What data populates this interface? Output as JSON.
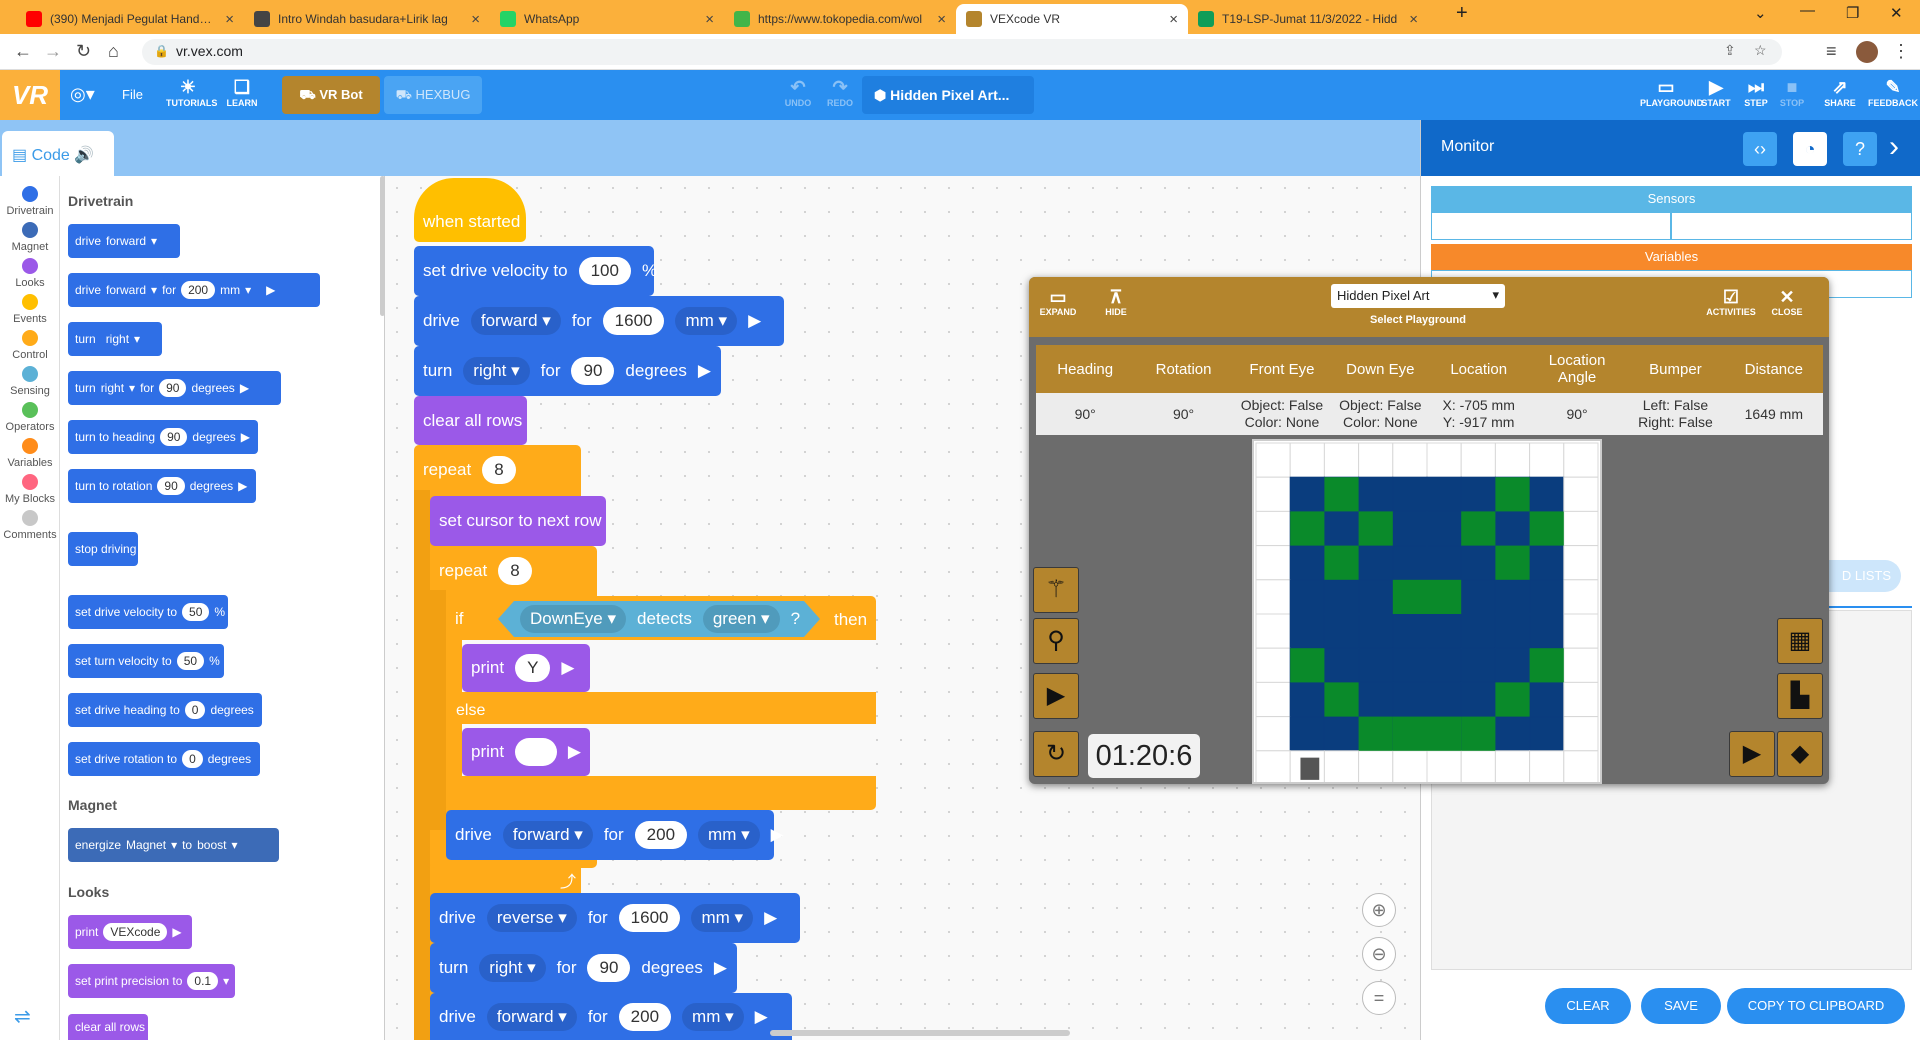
{
  "browser": {
    "tabs": [
      {
        "title": "(390) Menjadi Pegulat Handal - Y",
        "icon": "youtube-icon",
        "color": "#ff0000"
      },
      {
        "title": "Intro Windah basudara+Lirik lag",
        "icon": "music-note-icon",
        "color": "#444444"
      },
      {
        "title": "WhatsApp",
        "icon": "whatsapp-icon",
        "color": "#25d366"
      },
      {
        "title": "https://www.tokopedia.com/wol",
        "icon": "tokopedia-icon",
        "color": "#42b549"
      },
      {
        "title": "VEXcode VR",
        "icon": "vex-icon",
        "color": "#b4852d",
        "active": true
      },
      {
        "title": "T19-LSP-Jumat 11/3/2022 - Hidd",
        "icon": "sheets-icon",
        "color": "#0f9d58"
      }
    ],
    "new_tab": "+",
    "url": "vr.vex.com"
  },
  "header": {
    "logo": "VR",
    "file": "File",
    "tutorials": "TUTORIALS",
    "learn": "LEARN",
    "robots": [
      "VR Bot",
      "HEXBUG"
    ],
    "undo": "UNDO",
    "redo": "REDO",
    "project": "Hidden Pixel Art...",
    "right_buttons": [
      "PLAYGROUND",
      "START",
      "STEP",
      "STOP",
      "SHARE",
      "FEEDBACK"
    ]
  },
  "code_tab": "Code",
  "categories": [
    {
      "label": "Drivetrain",
      "color": "#2f6fe6"
    },
    {
      "label": "Magnet",
      "color": "#3c6bb7"
    },
    {
      "label": "Looks",
      "color": "#9b59e8"
    },
    {
      "label": "Events",
      "color": "#ffbf00"
    },
    {
      "label": "Control",
      "color": "#ffab19"
    },
    {
      "label": "Sensing",
      "color": "#5cb1d6"
    },
    {
      "label": "Operators",
      "color": "#59c059"
    },
    {
      "label": "Variables",
      "color": "#ff8c1a"
    },
    {
      "label": "My Blocks",
      "color": "#ff6680"
    },
    {
      "label": "Comments",
      "color": "#c8c8c8"
    }
  ],
  "palette": {
    "drivetrain_title": "Drivetrain",
    "drive": {
      "label": "drive",
      "dir": "forward"
    },
    "drive_for": {
      "label": "drive",
      "dir": "forward",
      "for": "for",
      "value": "200",
      "unit": "mm"
    },
    "turn": {
      "label": "turn",
      "dir": "right"
    },
    "turn_for": {
      "label": "turn",
      "dir": "right",
      "for": "for",
      "value": "90",
      "unit": "degrees"
    },
    "turn_heading": {
      "label": "turn to heading",
      "value": "90",
      "unit": "degrees"
    },
    "turn_rotation": {
      "label": "turn to rotation",
      "value": "90",
      "unit": "degrees"
    },
    "stop": "stop driving",
    "drive_velocity": {
      "label": "set drive velocity to",
      "value": "50",
      "unit": "%"
    },
    "turn_velocity": {
      "label": "set turn velocity to",
      "value": "50",
      "unit": "%"
    },
    "drive_heading": {
      "label": "set drive heading to",
      "value": "0",
      "unit": "degrees"
    },
    "drive_rotation": {
      "label": "set drive rotation to",
      "value": "0",
      "unit": "degrees"
    },
    "magnet_title": "Magnet",
    "energize": {
      "label": "energize",
      "target": "Magnet",
      "to": "to",
      "mode": "boost"
    },
    "looks_title": "Looks",
    "print": {
      "label": "print",
      "value": "VEXcode"
    },
    "precision": {
      "label": "set print precision to",
      "value": "0.1"
    },
    "clear": "clear all rows"
  },
  "script": {
    "when_started": "when started",
    "velocity": {
      "label": "set drive velocity to",
      "value": "100",
      "unit": "%"
    },
    "drive1": {
      "label": "drive",
      "dir": "forward",
      "for": "for",
      "value": "1600",
      "unit": "mm"
    },
    "turn1": {
      "label": "turn",
      "dir": "right",
      "for": "for",
      "value": "90",
      "unit": "degrees"
    },
    "clear": "clear all rows",
    "repeat1": {
      "label": "repeat",
      "value": "8"
    },
    "next_row": "set cursor to next row",
    "repeat2": {
      "label": "repeat",
      "value": "8"
    },
    "if": {
      "label": "if",
      "sensor": "DownEye",
      "detects": "detects",
      "color": "green",
      "q": "?",
      "then": "then"
    },
    "print_y": {
      "label": "print",
      "value": "Y"
    },
    "else": "else",
    "print_blank": {
      "label": "print",
      "value": ""
    },
    "drive2": {
      "label": "drive",
      "dir": "forward",
      "for": "for",
      "value": "200",
      "unit": "mm"
    },
    "drive3": {
      "label": "drive",
      "dir": "reverse",
      "for": "for",
      "value": "1600",
      "unit": "mm"
    },
    "turn2": {
      "label": "turn",
      "dir": "right",
      "for": "for",
      "value": "90",
      "unit": "degrees"
    },
    "drive4": {
      "label": "drive",
      "dir": "forward",
      "for": "for",
      "value": "200",
      "unit": "mm"
    }
  },
  "monitor": {
    "title": "Monitor",
    "sensors": "Sensors",
    "variables": "Variables",
    "lists_partial": "D LISTS",
    "buttons": [
      "CLEAR",
      "SAVE",
      "COPY TO CLIPBOARD"
    ]
  },
  "playground": {
    "expand": "EXPAND",
    "hide": "HIDE",
    "select_value": "Hidden Pixel Art",
    "select_label": "Select Playground",
    "activities": "ACTIVITIES",
    "close": "CLOSE",
    "headers": [
      "Heading",
      "Rotation",
      "Front Eye",
      "Down Eye",
      "Location",
      "Location Angle",
      "Bumper",
      "Distance"
    ],
    "values": [
      "90°",
      "90°",
      "Object: False\nColor: None",
      "Object: False\nColor: None",
      "X: -705 mm\nY: -917 mm",
      "90°",
      "Left: False\nRight: False",
      "1649 mm"
    ],
    "timer": "01:20:6",
    "field_colors": {
      "border": "#ffffff",
      "bg": "#0a3d7e",
      "pixel": "#0a8a2a"
    },
    "pixels": [
      [
        1,
        0
      ],
      [
        6,
        0
      ],
      [
        0,
        1
      ],
      [
        2,
        1
      ],
      [
        5,
        1
      ],
      [
        7,
        1
      ],
      [
        1,
        2
      ],
      [
        6,
        2
      ],
      [
        3,
        3
      ],
      [
        4,
        3
      ],
      [
        0,
        5
      ],
      [
        7,
        5
      ],
      [
        1,
        6
      ],
      [
        6,
        6
      ],
      [
        2,
        7
      ],
      [
        3,
        7
      ],
      [
        4,
        7
      ],
      [
        5,
        7
      ]
    ]
  }
}
